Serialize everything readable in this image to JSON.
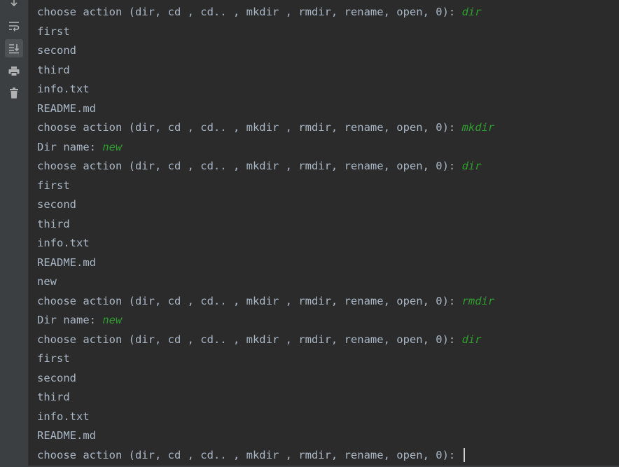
{
  "toolbar": {
    "icons": [
      "scroll-up-icon",
      "soft-wrap-icon",
      "scroll-to-end-icon",
      "print-icon",
      "trash-icon"
    ],
    "active_index": 2
  },
  "console": {
    "lines": [
      {
        "text": "choose action (dir, cd , cd.. , mkdir , rmdir, rename, open, 0): ",
        "input": "dir"
      },
      {
        "text": "first",
        "input": ""
      },
      {
        "text": "second",
        "input": ""
      },
      {
        "text": "third",
        "input": ""
      },
      {
        "text": "info.txt",
        "input": ""
      },
      {
        "text": "README.md",
        "input": ""
      },
      {
        "text": "choose action (dir, cd , cd.. , mkdir , rmdir, rename, open, 0): ",
        "input": "mkdir"
      },
      {
        "text": "Dir name: ",
        "input": "new"
      },
      {
        "text": "choose action (dir, cd , cd.. , mkdir , rmdir, rename, open, 0): ",
        "input": "dir"
      },
      {
        "text": "first",
        "input": ""
      },
      {
        "text": "second",
        "input": ""
      },
      {
        "text": "third",
        "input": ""
      },
      {
        "text": "info.txt",
        "input": ""
      },
      {
        "text": "README.md",
        "input": ""
      },
      {
        "text": "new",
        "input": ""
      },
      {
        "text": "choose action (dir, cd , cd.. , mkdir , rmdir, rename, open, 0): ",
        "input": "rmdir"
      },
      {
        "text": "Dir name: ",
        "input": "new"
      },
      {
        "text": "choose action (dir, cd , cd.. , mkdir , rmdir, rename, open, 0): ",
        "input": "dir"
      },
      {
        "text": "first",
        "input": ""
      },
      {
        "text": "second",
        "input": ""
      },
      {
        "text": "third",
        "input": ""
      },
      {
        "text": "info.txt",
        "input": ""
      },
      {
        "text": "README.md",
        "input": ""
      },
      {
        "text": "choose action (dir, cd , cd.. , mkdir , rmdir, rename, open, 0): ",
        "input": "",
        "cursor": true
      }
    ]
  },
  "colors": {
    "background": "#2b2b2b",
    "gutter": "#3c3f41",
    "output_text": "#a9b7c6",
    "user_input": "#2e9e2e",
    "icon": "#afb1b3"
  }
}
